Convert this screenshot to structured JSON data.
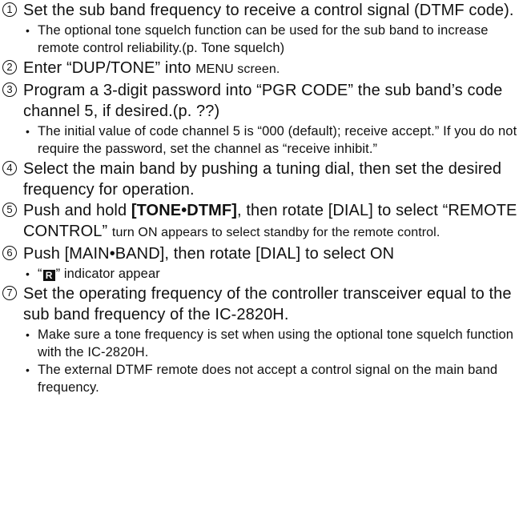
{
  "steps": [
    {
      "num": "1",
      "parts": [
        {
          "text": "Set the sub band frequency to receive a control signal (DTMF code)."
        }
      ],
      "notes": [
        "The optional tone squelch function can be used for the sub band to increase remote control reliability.(p. Tone squelch)"
      ]
    },
    {
      "num": "2",
      "parts": [
        {
          "text": "Enter “DUP/TONE” into "
        },
        {
          "text": "MENU screen.",
          "style": "sm"
        }
      ],
      "notes": []
    },
    {
      "num": "3",
      "parts": [
        {
          "text": "Program a 3-digit password into “PGR CODE” the sub band’s code channel 5, if desired.(p. ??)"
        }
      ],
      "notes": [
        "The initial value of code channel 5 is “000 (default); receive accept.” If you do not require the password, set the channel as “receive inhibit.”"
      ]
    },
    {
      "num": "4",
      "parts": [
        {
          "text": "Select the main band by pushing a tuning dial, then set the desired frequency for operation."
        }
      ],
      "notes": []
    },
    {
      "num": "5",
      "parts": [
        {
          "text": "Push and hold "
        },
        {
          "text": "[TONE•DTMF]",
          "style": "bold"
        },
        {
          "text": ", then rotate [DIAL] to select “REMOTE CONTROL” "
        },
        {
          "text": "turn ON appears to select standby for the remote control.",
          "style": "sm"
        }
      ],
      "notes": []
    },
    {
      "num": "6",
      "parts": [
        {
          "text": "Push [MAIN•BAND], then rotate [DIAL] to select ON"
        }
      ],
      "notes": [
        {
          "pre": "“",
          "icon": "R",
          "post": "” indicator appear"
        }
      ]
    },
    {
      "num": "7",
      "parts": [
        {
          "text": "Set the operating frequency of the controller transceiver equal to the sub band frequency of the IC-2820H."
        }
      ],
      "notes": [
        "Make sure a tone frequency is set when using the optional tone squelch function with the IC-2820H.",
        "The external DTMF remote does not accept a control signal on the main band frequency."
      ]
    }
  ]
}
